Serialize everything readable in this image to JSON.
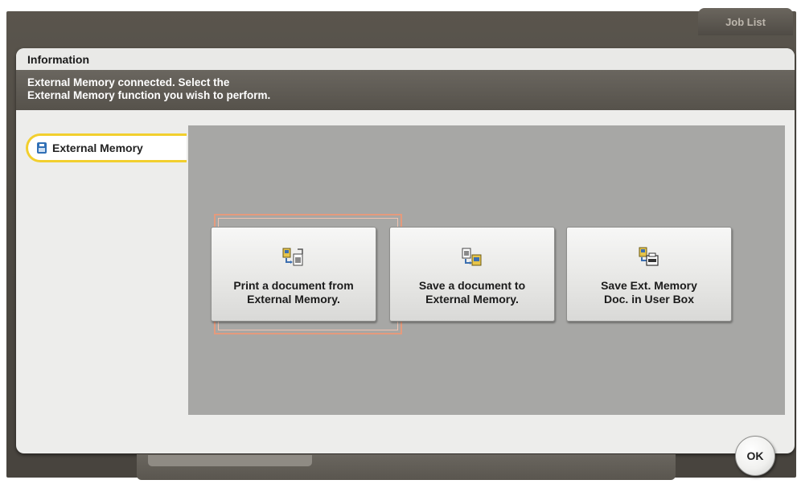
{
  "header": {
    "job_list_label": "Job List"
  },
  "dialog": {
    "title": "Information",
    "message_line1": "External Memory connected. Select the",
    "message_line2": "External Memory function you wish to perform."
  },
  "sidebar": {
    "tab_label": "External Memory",
    "tab_icon": "usb-memory-icon"
  },
  "functions": [
    {
      "line1": "Print a document from",
      "line2": "External Memory.",
      "icon": "print-from-memory-icon"
    },
    {
      "line1": "Save a document to",
      "line2": "External Memory.",
      "icon": "save-to-memory-icon"
    },
    {
      "line1": "Save Ext. Memory",
      "line2": "Doc. in User Box",
      "icon": "save-to-userbox-icon"
    }
  ],
  "footer": {
    "ok_label": "OK"
  },
  "colors": {
    "accent_tab": "#f2cf2e",
    "selection_frame": "#e59a7c",
    "panel": "#a7a7a5"
  }
}
